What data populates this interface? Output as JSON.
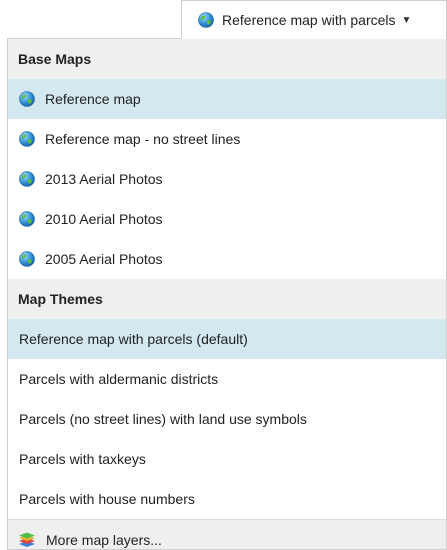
{
  "dropdown": {
    "selected_label": "Reference map with parcels",
    "caret_icon": "caret-down-icon",
    "globe_icon": "globe-icon"
  },
  "base_maps": {
    "header": "Base Maps",
    "items": [
      {
        "label": "Reference map",
        "icon": "globe-icon",
        "selected": true
      },
      {
        "label": "Reference map - no street lines",
        "icon": "globe-icon",
        "selected": false
      },
      {
        "label": "2013 Aerial Photos",
        "icon": "globe-icon",
        "selected": false
      },
      {
        "label": "2010 Aerial Photos",
        "icon": "globe-icon",
        "selected": false
      },
      {
        "label": "2005 Aerial Photos",
        "icon": "globe-icon",
        "selected": false
      }
    ]
  },
  "map_themes": {
    "header": "Map Themes",
    "items": [
      {
        "label": "Reference map with parcels (default)",
        "selected": true
      },
      {
        "label": "Parcels with aldermanic districts",
        "selected": false
      },
      {
        "label": "Parcels (no street lines) with land use symbols",
        "selected": false
      },
      {
        "label": "Parcels with taxkeys",
        "selected": false
      },
      {
        "label": "Parcels with house numbers",
        "selected": false
      }
    ]
  },
  "footer": {
    "label": "More map layers...",
    "icon": "layers-icon"
  },
  "colors": {
    "selected_row": "#d3e8ef",
    "header_bg": "#efefef",
    "border": "#cfcfcf",
    "text": "#222222"
  }
}
